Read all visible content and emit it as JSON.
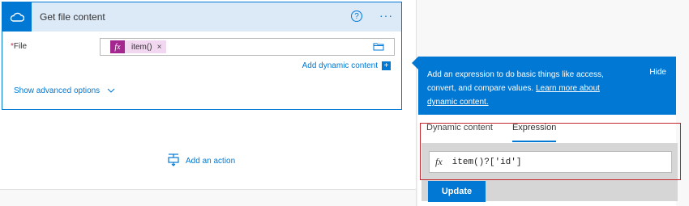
{
  "action_card": {
    "title": "Get file content",
    "help_symbol": "?",
    "more_symbol": "···",
    "file_label": "File",
    "required_marker": "*",
    "token_fx": "fx",
    "token_label": "item()",
    "token_remove": "×",
    "add_dynamic_label": "Add dynamic content",
    "add_dynamic_symbol": "+",
    "show_advanced_label": "Show advanced options"
  },
  "add_action_label": "Add an action",
  "expression_panel": {
    "description": "Add an expression to do basic things like access, convert, and compare values.",
    "learn_more_link": "Learn more about dynamic content.",
    "hide_label": "Hide",
    "tabs": [
      {
        "label": "Dynamic content",
        "active": false
      },
      {
        "label": "Expression",
        "active": true
      }
    ],
    "fx_symbol": "fx",
    "expression_value": "item()?['id']",
    "update_label": "Update"
  },
  "colors": {
    "accent": "#0078d4",
    "token_bg": "#f2d7f0",
    "token_fx_bg": "#a4268f",
    "highlight": "#c4262e"
  }
}
